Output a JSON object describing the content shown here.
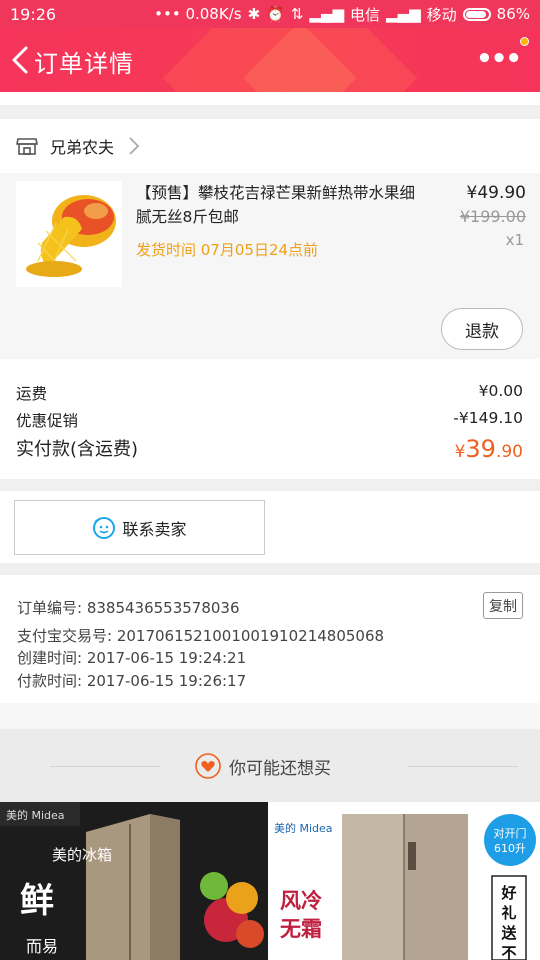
{
  "status_bar": {
    "time": "19:26",
    "network_speed": "0.08K/s",
    "carrier1": "电信",
    "carrier2": "移动",
    "battery": "86%"
  },
  "nav": {
    "title": "订单详情"
  },
  "store": {
    "name": "兄弟农夫"
  },
  "product": {
    "title": "【预售】攀枝花吉禄芒果新鲜热带水果细腻无丝8斤包邮",
    "ship_time": "发货时间 07月05日24点前",
    "price": "¥49.90",
    "original_price": "¥199.00",
    "quantity": "x1",
    "refund_label": "退款"
  },
  "fees": {
    "shipping_label": "运费",
    "shipping_value": "¥0.00",
    "discount_label": "优惠促销",
    "discount_value": "-¥149.10",
    "total_label": "实付款(含运费)",
    "total_symbol": "¥",
    "total_int": "39",
    "total_dec": ".90"
  },
  "contact": {
    "label": "联系卖家"
  },
  "order_info": {
    "order_no": "订单编号: 8385436553578036",
    "copy_label": "复制",
    "alipay_no": "支付宝交易号: 2017061521001001910214805068",
    "created": "创建时间: 2017-06-15 19:24:21",
    "paid": "付款时间: 2017-06-15 19:26:17"
  },
  "recommend": {
    "title": "你可能还想买",
    "card1": {
      "brand": "美的 Midea",
      "slogan1": "美的冰箱",
      "slogan_big": "鲜",
      "slogan2": "而易"
    },
    "card2": {
      "brand": "美的 Midea",
      "badge1": "对开门",
      "badge2": "610升",
      "slogan1": "风冷",
      "slogan2": "无霜",
      "side_text": "好礼送不"
    }
  },
  "colors": {
    "nav_bg": "#f5335b",
    "accent_orange": "#f06020",
    "ship_yellow": "#f0a018"
  }
}
